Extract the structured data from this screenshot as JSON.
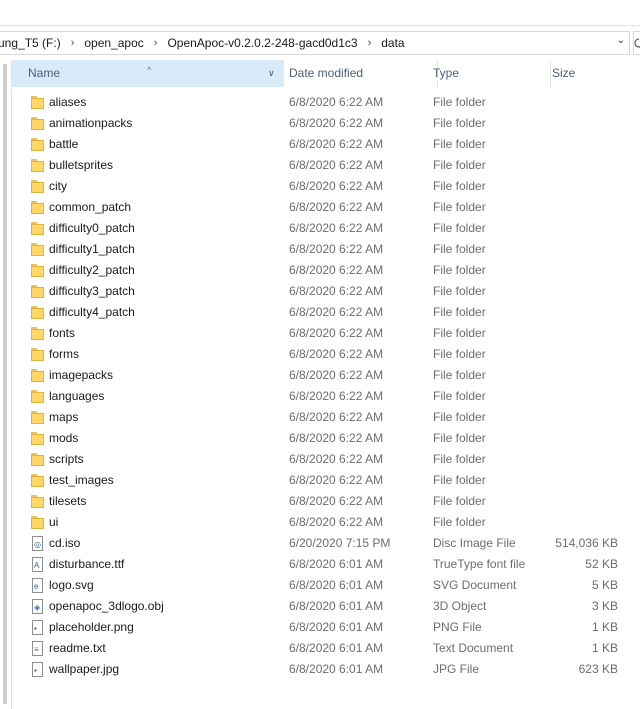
{
  "breadcrumb": {
    "items": [
      "ung_T5 (F:)",
      "open_apoc",
      "OpenApoc-v0.2.0.2-248-gacd0d1c3",
      "data"
    ],
    "separator": "›"
  },
  "header": {
    "name": "Name",
    "date_modified": "Date modified",
    "type": "Type",
    "size": "Size"
  },
  "colors": {
    "header_selected_bg": "#d9ebf9",
    "header_text": "#4c607a",
    "folder_fill": "#ffd766",
    "detail_text": "#6d6d6d"
  },
  "files": [
    {
      "name": "aliases",
      "date": "6/8/2020 6:22 AM",
      "type": "File folder",
      "size": "",
      "icon": "folder-icon"
    },
    {
      "name": "animationpacks",
      "date": "6/8/2020 6:22 AM",
      "type": "File folder",
      "size": "",
      "icon": "folder-icon"
    },
    {
      "name": "battle",
      "date": "6/8/2020 6:22 AM",
      "type": "File folder",
      "size": "",
      "icon": "folder-icon"
    },
    {
      "name": "bulletsprites",
      "date": "6/8/2020 6:22 AM",
      "type": "File folder",
      "size": "",
      "icon": "folder-icon"
    },
    {
      "name": "city",
      "date": "6/8/2020 6:22 AM",
      "type": "File folder",
      "size": "",
      "icon": "folder-icon"
    },
    {
      "name": "common_patch",
      "date": "6/8/2020 6:22 AM",
      "type": "File folder",
      "size": "",
      "icon": "folder-icon"
    },
    {
      "name": "difficulty0_patch",
      "date": "6/8/2020 6:22 AM",
      "type": "File folder",
      "size": "",
      "icon": "folder-icon"
    },
    {
      "name": "difficulty1_patch",
      "date": "6/8/2020 6:22 AM",
      "type": "File folder",
      "size": "",
      "icon": "folder-icon"
    },
    {
      "name": "difficulty2_patch",
      "date": "6/8/2020 6:22 AM",
      "type": "File folder",
      "size": "",
      "icon": "folder-icon"
    },
    {
      "name": "difficulty3_patch",
      "date": "6/8/2020 6:22 AM",
      "type": "File folder",
      "size": "",
      "icon": "folder-icon"
    },
    {
      "name": "difficulty4_patch",
      "date": "6/8/2020 6:22 AM",
      "type": "File folder",
      "size": "",
      "icon": "folder-icon"
    },
    {
      "name": "fonts",
      "date": "6/8/2020 6:22 AM",
      "type": "File folder",
      "size": "",
      "icon": "folder-icon"
    },
    {
      "name": "forms",
      "date": "6/8/2020 6:22 AM",
      "type": "File folder",
      "size": "",
      "icon": "folder-icon"
    },
    {
      "name": "imagepacks",
      "date": "6/8/2020 6:22 AM",
      "type": "File folder",
      "size": "",
      "icon": "folder-icon"
    },
    {
      "name": "languages",
      "date": "6/8/2020 6:22 AM",
      "type": "File folder",
      "size": "",
      "icon": "folder-icon"
    },
    {
      "name": "maps",
      "date": "6/8/2020 6:22 AM",
      "type": "File folder",
      "size": "",
      "icon": "folder-icon"
    },
    {
      "name": "mods",
      "date": "6/8/2020 6:22 AM",
      "type": "File folder",
      "size": "",
      "icon": "folder-icon"
    },
    {
      "name": "scripts",
      "date": "6/8/2020 6:22 AM",
      "type": "File folder",
      "size": "",
      "icon": "folder-icon"
    },
    {
      "name": "test_images",
      "date": "6/8/2020 6:22 AM",
      "type": "File folder",
      "size": "",
      "icon": "folder-icon"
    },
    {
      "name": "tilesets",
      "date": "6/8/2020 6:22 AM",
      "type": "File folder",
      "size": "",
      "icon": "folder-icon"
    },
    {
      "name": "ui",
      "date": "6/8/2020 6:22 AM",
      "type": "File folder",
      "size": "",
      "icon": "folder-icon"
    },
    {
      "name": "cd.iso",
      "date": "6/20/2020 7:15 PM",
      "type": "Disc Image File",
      "size": "514,036 KB",
      "icon": "disc-image-icon"
    },
    {
      "name": "disturbance.ttf",
      "date": "6/8/2020 6:01 AM",
      "type": "TrueType font file",
      "size": "52 KB",
      "icon": "font-file-icon"
    },
    {
      "name": "logo.svg",
      "date": "6/8/2020 6:01 AM",
      "type": "SVG Document",
      "size": "5 KB",
      "icon": "svg-document-icon"
    },
    {
      "name": "openapoc_3dlogo.obj",
      "date": "6/8/2020 6:01 AM",
      "type": "3D Object",
      "size": "3 KB",
      "icon": "3d-object-icon"
    },
    {
      "name": "placeholder.png",
      "date": "6/8/2020 6:01 AM",
      "type": "PNG File",
      "size": "1 KB",
      "icon": "image-file-icon"
    },
    {
      "name": "readme.txt",
      "date": "6/8/2020 6:01 AM",
      "type": "Text Document",
      "size": "1 KB",
      "icon": "text-file-icon"
    },
    {
      "name": "wallpaper.jpg",
      "date": "6/8/2020 6:01 AM",
      "type": "JPG File",
      "size": "623 KB",
      "icon": "image-file-icon"
    }
  ]
}
